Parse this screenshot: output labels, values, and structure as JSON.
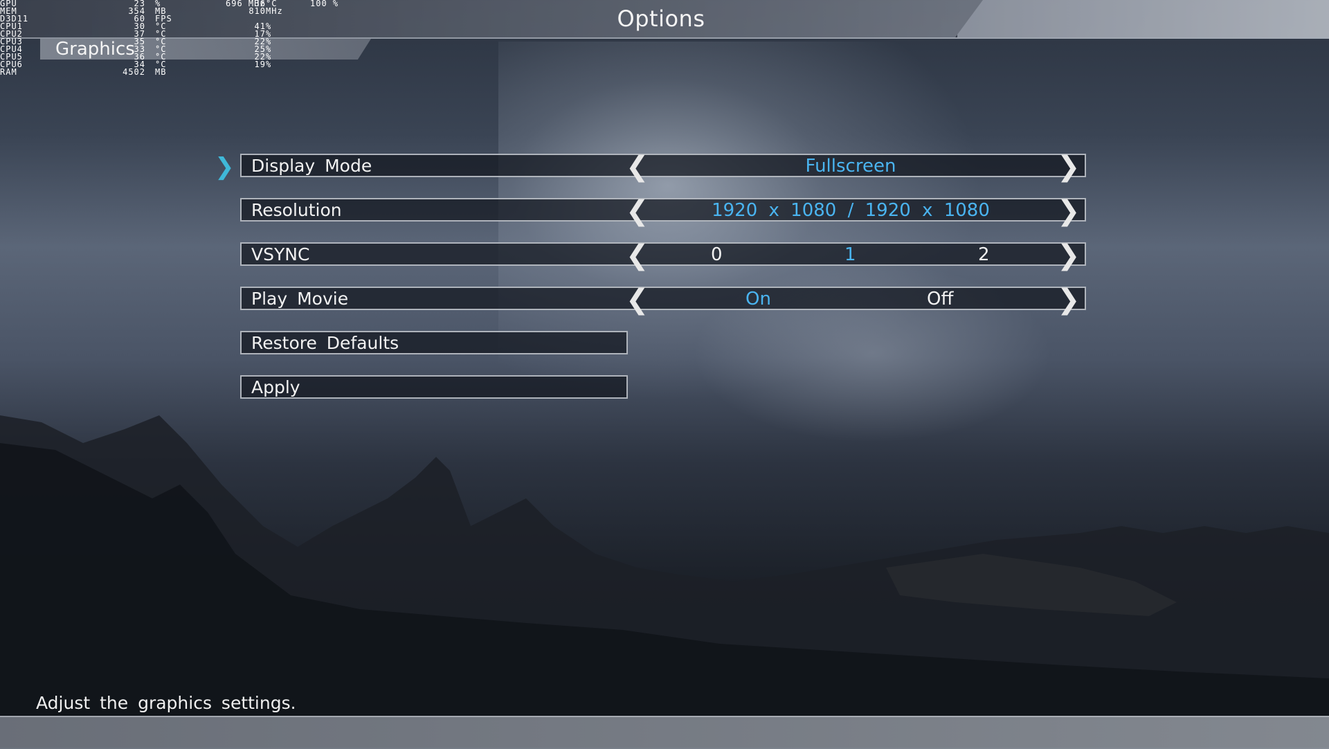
{
  "header": {
    "title": "Options"
  },
  "tab": {
    "label": "Graphics"
  },
  "osd": {
    "rows": [
      [
        "GPU",
        "23",
        "%",
        "36",
        "°C"
      ],
      [
        "MEM",
        "354",
        "MB",
        "810",
        "MHz"
      ],
      [
        "D3D11",
        "60",
        "FPS",
        "",
        ""
      ],
      [
        "CPU1",
        "30",
        "°C",
        "41",
        "%"
      ],
      [
        "CPU2",
        "37",
        "°C",
        "17",
        "%"
      ],
      [
        "CPU3",
        "35",
        "°C",
        "22",
        "%"
      ],
      [
        "CPU4",
        "33",
        "°C",
        "25",
        "%"
      ],
      [
        "CPU5",
        "36",
        "°C",
        "22",
        "%"
      ],
      [
        "CPU6",
        "34",
        "°C",
        "19",
        "%"
      ],
      [
        "RAM",
        "4502",
        "MB",
        "",
        ""
      ]
    ],
    "top_extra_1": "696 MHz",
    "top_extra_2": "100 %"
  },
  "menu": {
    "display_mode": {
      "label": "Display Mode",
      "value": "Fullscreen"
    },
    "resolution": {
      "label": "Resolution",
      "value": "1920 x 1080 / 1920 x 1080"
    },
    "vsync": {
      "label": "VSYNC",
      "options": [
        "0",
        "1",
        "2"
      ],
      "selected": "1"
    },
    "play_movie": {
      "label": "Play Movie",
      "options": [
        "On",
        "Off"
      ],
      "selected": "On"
    },
    "restore_defaults": {
      "label": "Restore Defaults"
    },
    "apply": {
      "label": "Apply"
    }
  },
  "footer": {
    "hint": "Adjust the graphics settings."
  },
  "colors": {
    "accent": "#4ab4f0",
    "cursor": "#3fb8d8"
  },
  "icons": {
    "left_arrow": "chevron-left-icon",
    "right_arrow": "chevron-right-icon",
    "cursor": "selection-chevron-icon"
  }
}
